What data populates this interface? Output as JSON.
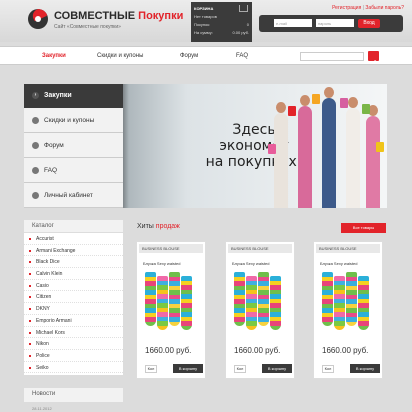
{
  "header": {
    "brand_main": "СОВМЕСТНЫЕ",
    "brand_accent": "Покупки",
    "tagline": "Сайт «Совместные покупки»",
    "register_link": "Регистрация",
    "sep": "|",
    "forgot_link": "Забыли пароль?",
    "login_placeholder": "e-mail",
    "password_placeholder": "пароль",
    "login_button": "Вход"
  },
  "cart": {
    "title": "КОРЗИНА",
    "subtitle": "Нет товаров",
    "qty_label": "Покупок:",
    "qty_value": "0",
    "sum_label": "На сумму:",
    "sum_value": "0.00 руб."
  },
  "nav": {
    "items": [
      {
        "label": "Закупки"
      },
      {
        "label": "Скидки и купоны"
      },
      {
        "label": "Форум"
      },
      {
        "label": "FAQ"
      }
    ],
    "search_placeholder": ""
  },
  "banner": {
    "menu_header": "Закупки",
    "menu": [
      {
        "label": "Скидки и купоны"
      },
      {
        "label": "Форум"
      },
      {
        "label": "FAQ"
      },
      {
        "label": "Личный кабинет"
      }
    ],
    "slogan_lines": [
      "Здесь",
      "экономят",
      "на покупках!"
    ]
  },
  "catalog": {
    "title": "Каталог",
    "items": [
      "Accurist",
      "Armani Exchange",
      "Black Dice",
      "Calvin Klein",
      "Casio",
      "Citizen",
      "DKNY",
      "Emporio Armani",
      "Michael Kors",
      "Nikon",
      "Police",
      "Seiko"
    ]
  },
  "news": {
    "title": "Новости",
    "date": "28.11.2012"
  },
  "hits": {
    "title_main": "Хиты",
    "title_accent": "продаж",
    "new_button": "Все товары"
  },
  "products": [
    {
      "category": "BUSINESS BLOUSE",
      "name": "Блузка Sexy waisted",
      "price": "1660.00 руб.",
      "qty": "Кол",
      "buy": "В корзину"
    },
    {
      "category": "BUSINESS BLOUSE",
      "name": "Блузка Sexy waisted",
      "price": "1660.00 руб.",
      "qty": "Кол",
      "buy": "В корзину"
    },
    {
      "category": "BUSINESS BLOUSE",
      "name": "Блузка Sexy waisted",
      "price": "1660.00 руб.",
      "qty": "Кол",
      "buy": "В корзину"
    }
  ],
  "colors": {
    "accent": "#e2232a",
    "dark": "#3a3a3a"
  }
}
